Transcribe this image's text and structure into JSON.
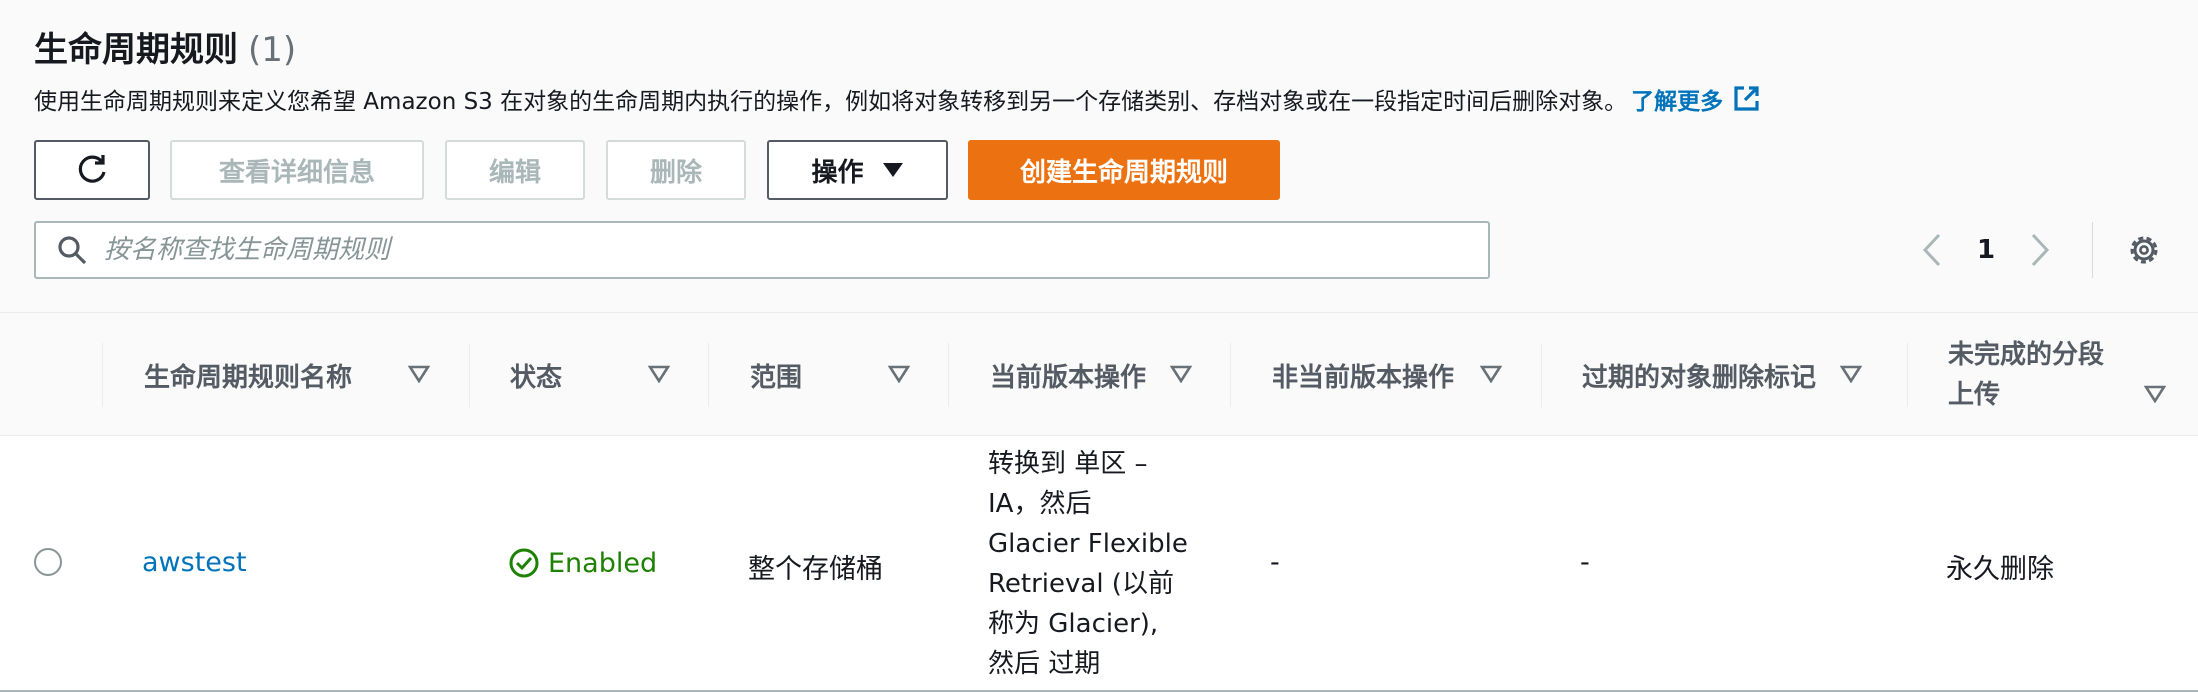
{
  "header": {
    "title": "生命周期规则",
    "count": "(1)",
    "description": "使用生命周期规则来定义您希望 Amazon S3 在对象的生命周期内执行的操作，例如将对象转移到另一个存储类别、存档对象或在一段指定时间后删除对象。",
    "learn_more": "了解更多"
  },
  "toolbar": {
    "refresh_icon": "refresh-icon",
    "view_details": "查看详细信息",
    "edit": "编辑",
    "delete": "删除",
    "actions": "操作",
    "create": "创建生命周期规则"
  },
  "search": {
    "placeholder": "按名称查找生命周期规则"
  },
  "pagination": {
    "current_page": "1"
  },
  "table": {
    "columns": [
      "生命周期规则名称",
      "状态",
      "范围",
      "当前版本操作",
      "非当前版本操作",
      "过期的对象删除标记",
      "未完成的分段上传"
    ],
    "rows": [
      {
        "name": "awstest",
        "status": "Enabled",
        "scope": "整个存储桶",
        "current_version_actions": [
          "转换到 单区 –",
          "IA，然后",
          "Glacier Flexible",
          "Retrieval (以前",
          "称为 Glacier),",
          "然后 过期"
        ],
        "noncurrent_version_actions": "-",
        "expired_delete_markers": "-",
        "incomplete_multipart": "永久删除"
      }
    ]
  },
  "colors": {
    "accent": "#ec7211",
    "link": "#0073bb",
    "success": "#1d8102"
  }
}
